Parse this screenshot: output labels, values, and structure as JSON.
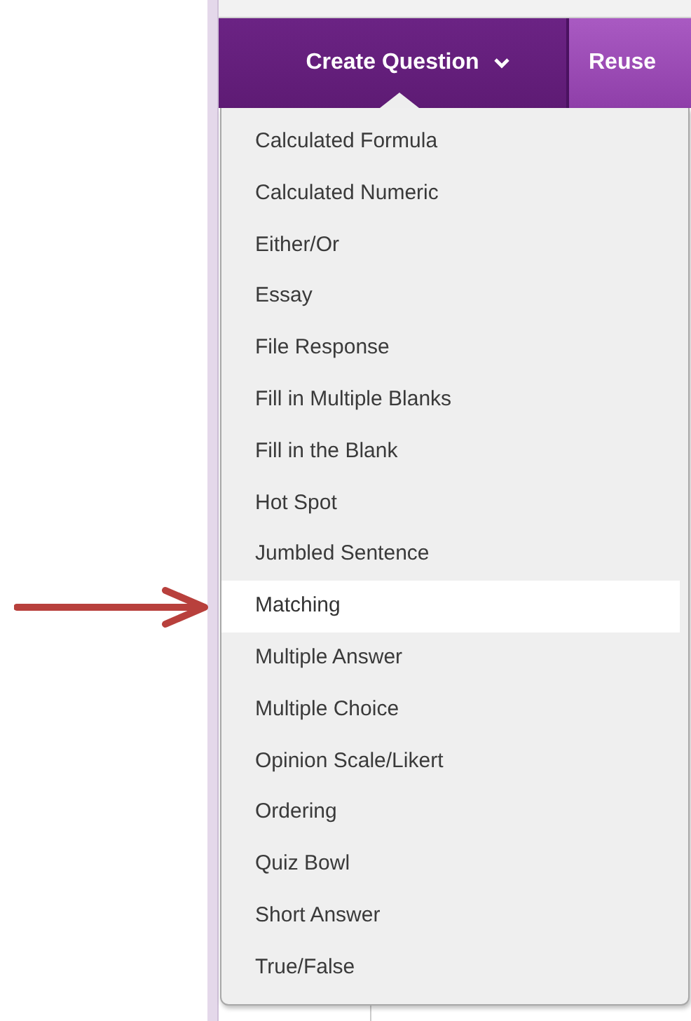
{
  "toolbar": [
    {
      "label": "Create Question",
      "kind": "dropdown",
      "expanded": true
    },
    {
      "label": "Reuse",
      "kind": "button"
    }
  ],
  "menu": {
    "items": [
      {
        "label": "Calculated Formula",
        "selected": false
      },
      {
        "label": "Calculated Numeric",
        "selected": false
      },
      {
        "label": "Either/Or",
        "selected": false
      },
      {
        "label": "Essay",
        "selected": false
      },
      {
        "label": "File Response",
        "selected": false
      },
      {
        "label": "Fill in Multiple Blanks",
        "selected": false
      },
      {
        "label": "Fill in the Blank",
        "selected": false
      },
      {
        "label": "Hot Spot",
        "selected": false
      },
      {
        "label": "Jumbled Sentence",
        "selected": false
      },
      {
        "label": "Matching",
        "selected": true
      },
      {
        "label": "Multiple Answer",
        "selected": false
      },
      {
        "label": "Multiple Choice",
        "selected": false
      },
      {
        "label": "Opinion Scale/Likert",
        "selected": false
      },
      {
        "label": "Ordering",
        "selected": false
      },
      {
        "label": "Quiz Bowl",
        "selected": false
      },
      {
        "label": "Short Answer",
        "selected": false
      },
      {
        "label": "True/False",
        "selected": false
      }
    ]
  },
  "annotation": {
    "kind": "arrow"
  }
}
